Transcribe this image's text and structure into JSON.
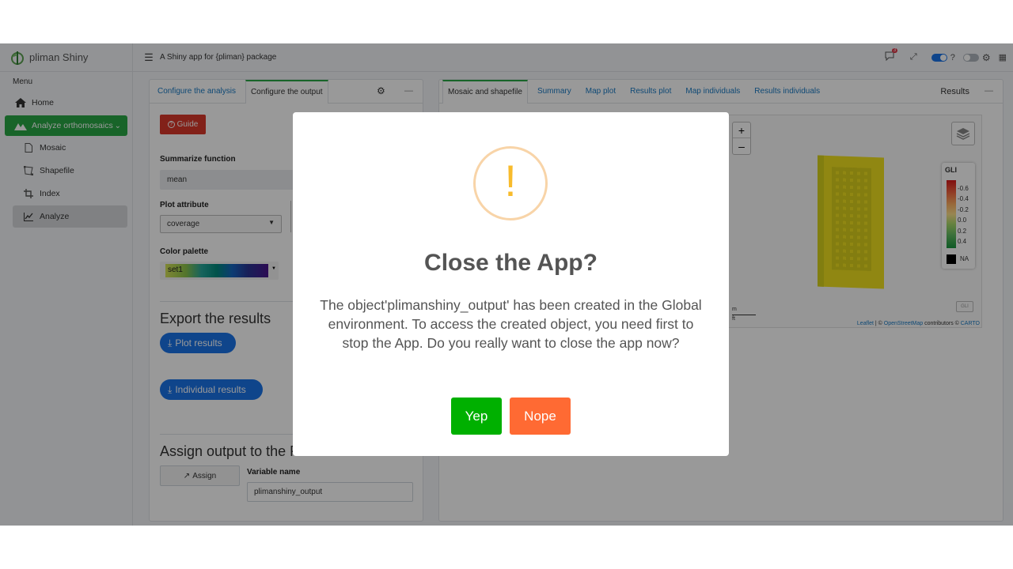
{
  "brand": {
    "name": "pliman Shiny"
  },
  "topbar": {
    "title": "A Shiny app for {pliman} package",
    "badge": "3",
    "help": "?"
  },
  "sidebar": {
    "menu_label": "Menu",
    "items": [
      {
        "label": "Home",
        "icon": "home-icon"
      },
      {
        "label": "Analyze orthomosaics",
        "icon": "mountain-icon"
      },
      {
        "label": "Mosaic",
        "icon": "document-icon"
      },
      {
        "label": "Shapefile",
        "icon": "shape-icon"
      },
      {
        "label": "Index",
        "icon": "crop-icon"
      },
      {
        "label": "Analyze",
        "icon": "chart-line-icon"
      }
    ]
  },
  "left_card": {
    "tabs": [
      "Configure the analysis",
      "Configure the output"
    ],
    "guide_label": "Guide",
    "summarize_label": "Summarize function",
    "summarize_value": "mean",
    "plot_attr_label": "Plot attribute",
    "plot_attr_value": "coverage",
    "palette_label": "Color palette",
    "palette_value": "set1",
    "export_title": "Export the results",
    "plot_results_label": "Plot results",
    "individual_results_label": "Individual results",
    "assign_title": "Assign output to the R environment",
    "assign_button": "Assign",
    "var_name_label": "Variable name",
    "var_name_value": "plimanshiny_output"
  },
  "right_card": {
    "tabs": [
      "Mosaic and shapefile",
      "Summary",
      "Map plot",
      "Results plot",
      "Map individuals",
      "Results individuals"
    ],
    "title": "Results",
    "map": {
      "zoom_in": "+",
      "zoom_out": "–",
      "legend_title": "GLI",
      "legend_ticks": [
        "-0.6",
        "-0.4",
        "-0.2",
        "0.0",
        "0.2",
        "0.4"
      ],
      "na_label": "NA",
      "scale_m": "m",
      "scale_ft": "ft",
      "gli_badge": "GLI",
      "attribution_leaflet": "Leaflet",
      "attribution_sep1": " | © ",
      "attribution_osm": "OpenStreetMap",
      "attribution_mid": " contributors © ",
      "attribution_carto": "CARTO"
    }
  },
  "modal": {
    "icon": "!",
    "title": "Close the App?",
    "text": "The object'plimanshiny_output' has been created in the Global environment. To access the created object, you need first to stop the App. Do you really want to close the app now?",
    "confirm_label": "Yep",
    "cancel_label": "Nope",
    "confirm_color": "#00b000",
    "cancel_color": "#ff6a33"
  },
  "colors": {
    "accent_green": "#28a745",
    "link_blue": "#1a7bc4",
    "pill_blue": "#1a73e8",
    "guide_red": "#d9372b"
  }
}
